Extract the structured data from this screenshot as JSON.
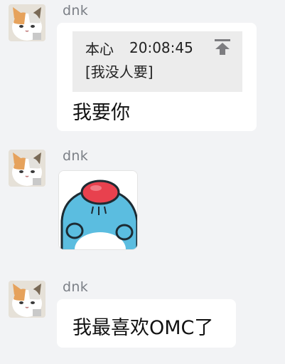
{
  "messages": [
    {
      "sender": "dnk",
      "avatar_icon": "cat-avatar-icon",
      "reply": {
        "name": "本心",
        "time": "20:08:45",
        "text": "[我没人要]",
        "jump_icon": "jump-to-top-icon"
      },
      "text": "我要你"
    },
    {
      "sender": "dnk",
      "avatar_icon": "cat-avatar-icon",
      "sticker": "blue-creature-red-cap-sticker"
    },
    {
      "sender": "dnk",
      "avatar_icon": "cat-avatar-icon",
      "text": "我最喜欢OMC了"
    }
  ],
  "colors": {
    "background": "#f2f3f5",
    "bubble": "#ffffff",
    "quote_bg": "#ececec",
    "sender": "#7b7f86",
    "text": "#111111"
  }
}
